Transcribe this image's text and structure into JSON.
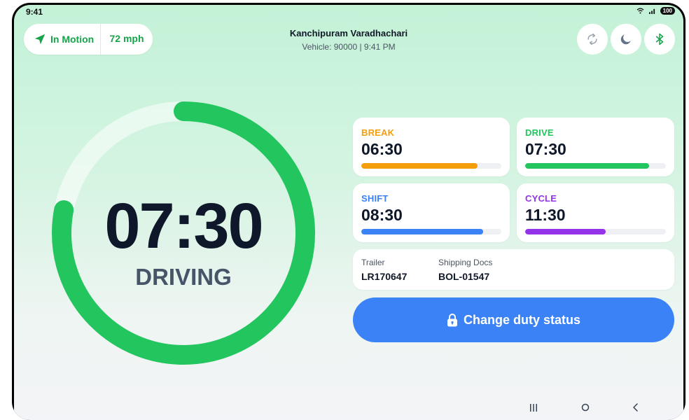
{
  "status_bar": {
    "time": "9:41",
    "battery": "100"
  },
  "motion": {
    "status": "In Motion",
    "speed": "72 mph"
  },
  "header": {
    "driver_name": "Kanchipuram Varadhachari",
    "vehicle_line": "Vehicle: 90000 | 9:41 PM"
  },
  "toolbar": {
    "icons": [
      "sync-icon",
      "dark-mode-icon",
      "bluetooth-icon"
    ]
  },
  "main_timer": {
    "time": "07:30",
    "status": "DRIVING",
    "progress": 0.78,
    "color": "#22c55e"
  },
  "clocks": [
    {
      "label": "BREAK",
      "value": "06:30",
      "progress": 0.83,
      "color": "#f59e0b"
    },
    {
      "label": "DRIVE",
      "value": "07:30",
      "progress": 0.88,
      "color": "#22c55e"
    },
    {
      "label": "SHIFT",
      "value": "08:30",
      "progress": 0.87,
      "color": "#3b82f6"
    },
    {
      "label": "CYCLE",
      "value": "11:30",
      "progress": 0.57,
      "color": "#9333ea"
    }
  ],
  "trip_info": {
    "trailer_label": "Trailer",
    "trailer_value": "LR170647",
    "docs_label": "Shipping Docs",
    "docs_value": "BOL-01547"
  },
  "cta": {
    "label": "Change duty status",
    "color": "#3b82f6"
  },
  "nav": {
    "icons": [
      "recents-icon",
      "home-icon",
      "back-icon"
    ]
  }
}
